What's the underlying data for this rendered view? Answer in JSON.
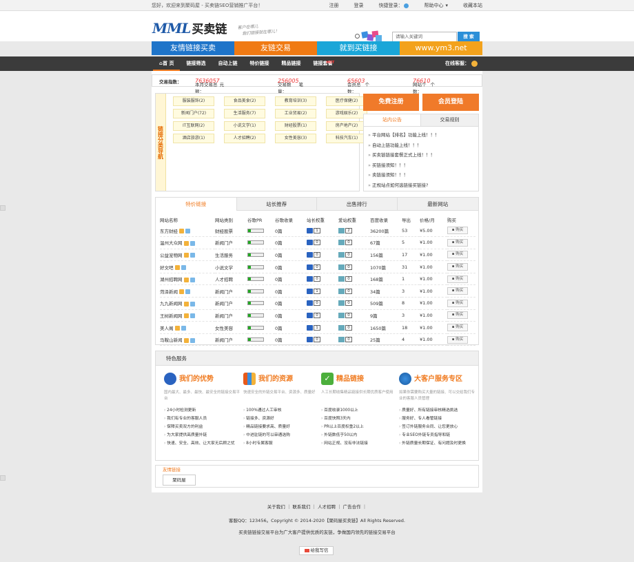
{
  "topbar": {
    "welcome": "您好，欢迎来到聚码屋 - 买卖链SEO营销推广平台！",
    "register": "注册",
    "login": "登录",
    "quick_login": "快捷登录：",
    "help": "帮助中心",
    "bookmark": "收藏本站"
  },
  "header": {
    "logo_mml": "MML",
    "logo_cn": "买卖链",
    "slogan_line1": "客户在哪儿",
    "slogan_line2": "我们链接就在哪儿！",
    "search_placeholder": "请输入关键词",
    "search_button": "搜 索"
  },
  "banners": [
    {
      "label": "友情链接买卖",
      "color": "#1e74c9"
    },
    {
      "label": "友链交易",
      "color": "#f07a13"
    },
    {
      "label": "就到买链接",
      "color": "#1aa6d8"
    },
    {
      "label": "www.ym3.net",
      "color": "#f3a21c"
    }
  ],
  "nav": {
    "items": [
      "⌂首 页",
      "链接筛选",
      "自动上链",
      "特价链接",
      "精品链接",
      "链接套餐"
    ],
    "hot": "HOT",
    "online_service": "在线客服："
  },
  "stats": {
    "label": "交易指数：",
    "month_total_label": "本月交易总额：",
    "month_total": "7636057",
    "month_total_unit": "元",
    "trade_count_label": "交易数量：",
    "trade_count": "256005",
    "trade_count_unit": "笔",
    "members_label": "会员总数：",
    "members": "65603",
    "members_unit": "个",
    "sites_label": "网站个数：",
    "sites": "76610",
    "sites_unit": "个"
  },
  "categories": {
    "side_title": "链接分类导航",
    "items": [
      "服装服饰(2)",
      "食品美食(2)",
      "教育培训(3)",
      "医疗保健(2)",
      "新闻门户(72)",
      "生活服务(7)",
      "工业贸易(2)",
      "游戏娱乐(2)",
      "IT互联网(2)",
      "小说文学(1)",
      "财经股票(1)",
      "房产地产(2)",
      "酒店旅游(1)",
      "人才招聘(2)",
      "女性美容(3)",
      "科技汽车(1)"
    ]
  },
  "auth": {
    "register_button": "免费注册",
    "login_button": "会员登陆"
  },
  "notice": {
    "tab_active": "站内公告",
    "tab_other": "交易规则",
    "items": [
      "平台网站【排名】功能上线！！！",
      "自动上链功能上线！！！",
      "买卖链链接套餐正式上线！！！",
      "买链接须知！！！",
      "卖链接须知！！！",
      "正规站点如何选链接买链接?"
    ]
  },
  "table": {
    "tabs": [
      "特价链接",
      "站长推荐",
      "出售排行",
      "最新网站"
    ],
    "headers": [
      "网站名称",
      "网站类别",
      "谷歌PR",
      "谷歌收录",
      "站长权重",
      "爱站权重",
      "百度收录",
      "导出",
      "价格/月",
      "购买"
    ],
    "buy_label": "购买",
    "rows": [
      {
        "name": "东方财经",
        "category": "财经股票",
        "google": "0篇",
        "zz": "1",
        "az": "2",
        "baidu": "36200篇",
        "out": "53",
        "price": "¥5.00"
      },
      {
        "name": "温州大众网",
        "category": "新闻门户",
        "google": "0篇",
        "zz": "0",
        "az": "0",
        "baidu": "67篇",
        "out": "5",
        "price": "¥1.00"
      },
      {
        "name": "公益宠物网",
        "category": "生活服务",
        "google": "0篇",
        "zz": "0",
        "az": "0",
        "baidu": "156篇",
        "out": "17",
        "price": "¥1.00"
      },
      {
        "name": "好文吧",
        "category": "小说文学",
        "google": "0篇",
        "zz": "0",
        "az": "0",
        "baidu": "1070篇",
        "out": "31",
        "price": "¥1.00"
      },
      {
        "name": "湖州招聘网",
        "category": "人才招聘",
        "google": "0篇",
        "zz": "0",
        "az": "0",
        "baidu": "168篇",
        "out": "1",
        "price": "¥1.00"
      },
      {
        "name": "菏泽新闻",
        "category": "新闻门户",
        "google": "0篇",
        "zz": "1",
        "az": "0",
        "baidu": "34篇",
        "out": "3",
        "price": "¥1.00"
      },
      {
        "name": "九九新闻网",
        "category": "新闻门户",
        "google": "0篇",
        "zz": "0",
        "az": "0",
        "baidu": "509篇",
        "out": "8",
        "price": "¥1.00"
      },
      {
        "name": "王树新闻网",
        "category": "新闻门户",
        "google": "0篇",
        "zz": "0",
        "az": "0",
        "baidu": "9篇",
        "out": "3",
        "price": "¥1.00"
      },
      {
        "name": "美人阁",
        "category": "女性美容",
        "google": "0篇",
        "zz": "1",
        "az": "0",
        "baidu": "1650篇",
        "out": "18",
        "price": "¥1.00"
      },
      {
        "name": "马鞍山新闻",
        "category": "新闻门户",
        "google": "0篇",
        "zz": "0",
        "az": "0",
        "baidu": "25篇",
        "out": "4",
        "price": "¥1.00"
      }
    ]
  },
  "services": {
    "title": "特色服务",
    "cols": [
      {
        "title": "我们的优势",
        "icon_color": "#2a63c0",
        "desc": "国内最大、最多、最快、最安全的链接交易平台",
        "items": [
          "24小时检测更新",
          "我们有专业的客服人员",
          "保障买卖双方的利益",
          "为大家提供高质量外链",
          "快速、安全、高效、让大家无后顾之忧"
        ]
      },
      {
        "title": "我们的资源",
        "icon_color": "#e85a1a",
        "desc": "快速安全的外链交易平台、资源多、质量好",
        "items": [
          "100%通过人工审核",
          "链接多、资源好",
          "精品链接要求高、质量好",
          "中进驻链的可以审通选购",
          "8小时专属客服"
        ]
      },
      {
        "title": "精品链接",
        "icon_color": "#4caf3c",
        "desc": "人工长期收集精品链接供长期优质客户使用",
        "items": [
          "百度收录1000以上",
          "百度快照3天内",
          "PR以上百度权重2以上",
          "外链数低于50以内",
          "网站正规、没有非法链接"
        ]
      },
      {
        "title": "大客户服务专区",
        "icon_color": "#1a5aa0",
        "desc": "如果你需要购买大量的链接、可以交给我们专业的客服人员管理",
        "items": [
          "质量好、所有链接审核精选挑选",
          "服务好、专人看管链接",
          "签订外链服务合同、让您更放心",
          "专业SEO外链专员指导和链",
          "外链质量长期保证、有问题及时更换"
        ]
      }
    ]
  },
  "friend_links": {
    "title": "友情链接",
    "items": [
      "聚码屋"
    ]
  },
  "footer": {
    "links": "关于我们 ｜ 联系我们 ｜ 人才招聘 ｜ 广告合作 ｜",
    "copyright": "客服QQ：123456。Copyright © 2014-2020【聚码屋买卖链】All Rights Reserved.",
    "tagline": "买卖链链接交易平台为广大客户提供优质的友链，争做国内领先的链接交易平台",
    "message_button": "给我写信"
  }
}
